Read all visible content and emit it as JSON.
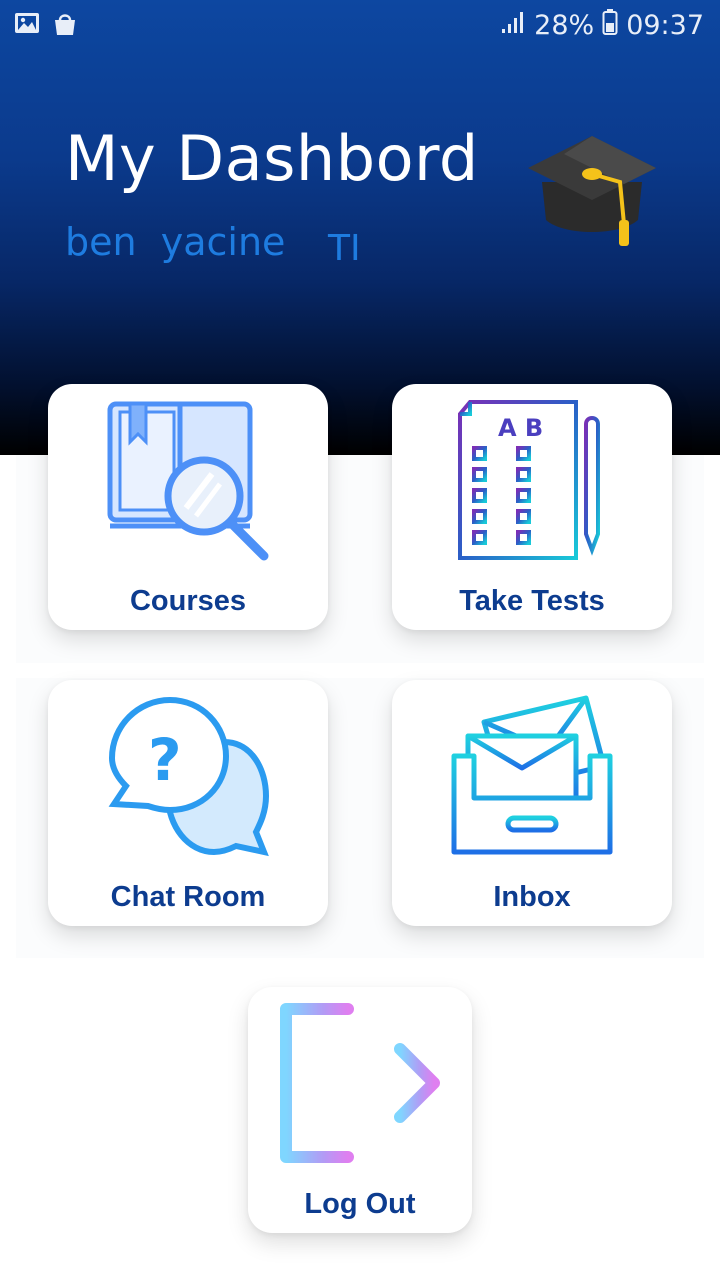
{
  "status_bar": {
    "left_icons": [
      "image-icon",
      "shopping-bag-icon"
    ],
    "signal_icon": "signal-icon",
    "battery_percent": "28%",
    "battery_icon": "battery-icon",
    "time": "09:37"
  },
  "header": {
    "title": "My Dashbord",
    "user_name": "ben  yacine",
    "user_class": "TI",
    "icon": "graduation-cap-icon"
  },
  "menu": {
    "courses": {
      "label": "Courses",
      "icon": "book-search-icon"
    },
    "tests": {
      "label": "Take Tests",
      "icon": "test-sheet-icon"
    },
    "chat": {
      "label": "Chat Room",
      "icon": "chat-question-icon"
    },
    "inbox": {
      "label": "Inbox",
      "icon": "inbox-tray-icon"
    },
    "logout": {
      "label": "Log Out",
      "icon": "logout-arrow-icon"
    }
  },
  "colors": {
    "header_top": "#0d47a1",
    "header_bottom": "#000000",
    "accent_text": "#1e7ce0",
    "card_label": "#0d3c8f"
  }
}
